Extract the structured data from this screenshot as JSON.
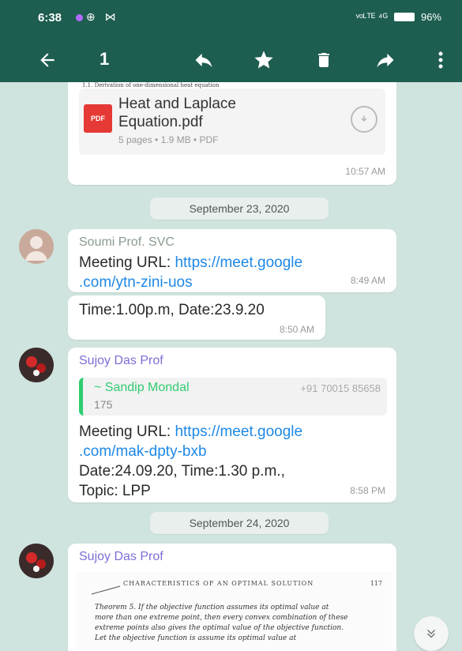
{
  "status": {
    "time": "6:38",
    "icons_left": "⊕ ⋈",
    "signal_text": "ᵛᵒᴸᵀᴱ ⁴ᴳ",
    "battery": "96%"
  },
  "action_bar": {
    "selected_count": "1",
    "icons": [
      "back-icon",
      "reply-icon",
      "star-icon",
      "delete-icon",
      "forward-icon",
      "more-icon"
    ]
  },
  "messages": {
    "doc1": {
      "header_snippet": "1.1. Derivation of one-dimensional heat equation",
      "file_name": "Heat and Laplace Equation.pdf",
      "file_meta": "5 pages • 1.9 MB • PDF",
      "time": "10:57 AM"
    },
    "date1": "September 23, 2020",
    "m1": {
      "sender": "Soumi Prof. SVC",
      "label": "Meeting URL: ",
      "link_line1": "https://meet.google",
      "link_line2": ".com/ytn-zini-uos",
      "time": "8:49 AM"
    },
    "m2": {
      "text": "Time:1.00p.m, Date:23.9.20",
      "time": "8:50 AM"
    },
    "m3": {
      "sender": "Sujoy Das Prof",
      "quote_name": "~ Sandip Mondal",
      "quote_number": "+91 70015 85658",
      "quote_text": "175",
      "label": "Meeting URL: ",
      "link_line1": "https://meet.google",
      "link_line2": ".com/mak-dpty-bxb",
      "line3": "Date:24.09.20, Time:1.30 p.m.,",
      "line4": "Topic: LPP",
      "time": "8:58 PM"
    },
    "date2": "September 24, 2020",
    "m4": {
      "sender": "Sujoy Das Prof",
      "preview_heading": "CHARACTERISTICS OF AN OPTIMAL SOLUTION",
      "preview_page": "117",
      "preview_lines": [
        "Theorem 5. If the objective function assumes its optimal value at",
        "more than one extreme point, then every convex combination of these",
        "extreme points also gives the optimal value of the objective function.",
        "Let the objective function is assume its optimal value at"
      ]
    }
  },
  "colors": {
    "header": "#1d5e50",
    "chat_bg": "#cfe3df",
    "bubble": "#ffffff",
    "link": "#1e88e5",
    "sender_green": "#8a9c8f",
    "sender_purple": "#7b6fd6",
    "quote_green": "#2ecc71"
  }
}
